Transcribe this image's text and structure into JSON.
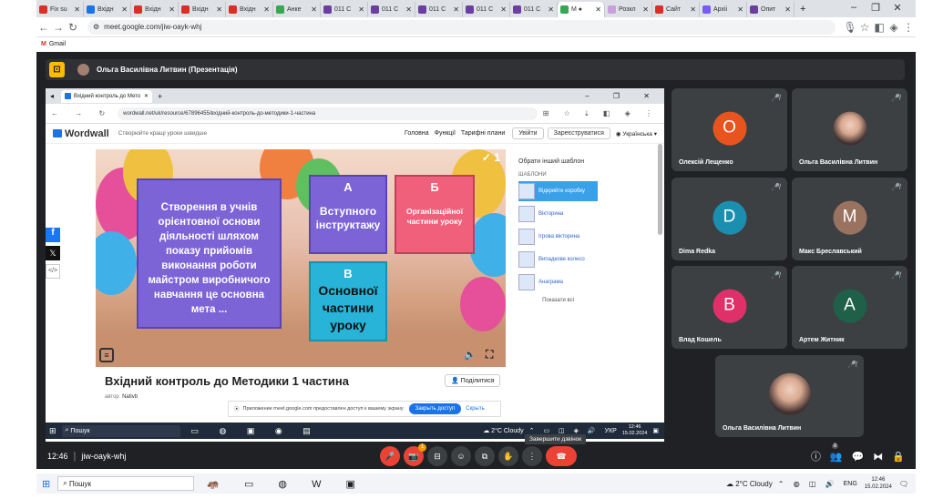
{
  "outer_tabs": [
    {
      "label": "Fix su",
      "color": "#d93025"
    },
    {
      "label": "Вхідн",
      "color": "#1a73e8"
    },
    {
      "label": "Вхідн",
      "color": "#d93025"
    },
    {
      "label": "Вхідн",
      "color": "#d93025"
    },
    {
      "label": "Вхідн",
      "color": "#d93025"
    },
    {
      "label": "Анке",
      "color": "#34a853"
    },
    {
      "label": "011 С",
      "color": "#6a3fa0"
    },
    {
      "label": "011 С",
      "color": "#6a3fa0"
    },
    {
      "label": "011 С",
      "color": "#6a3fa0"
    },
    {
      "label": "011 С",
      "color": "#6a3fa0"
    },
    {
      "label": "011 С",
      "color": "#6a3fa0"
    },
    {
      "label": "М ●",
      "color": "#34a853",
      "active": true
    },
    {
      "label": "Розкл",
      "color": "#c9a0dc"
    },
    {
      "label": "Сайт",
      "color": "#d93025"
    },
    {
      "label": "Архіі",
      "color": "#7a5af5"
    },
    {
      "label": "Опит",
      "color": "#6a3fa0"
    }
  ],
  "address": {
    "url": "meet.google.com/jiw-oayk-whj"
  },
  "bookmarks": {
    "gmail": "Gmail"
  },
  "meet_header": {
    "title": "Ольга Василівна Литвин (Презентація)"
  },
  "inner_browser": {
    "tab_label": "Вхідний контроль до Мето",
    "url": "wordwall.net/uk/resource/67896455/вхідний-контроль-до-методики-1-частина"
  },
  "wordwall": {
    "logo": "Wordwall",
    "tagline": "Створюйте кращі уроки швидше",
    "nav": [
      "Головна",
      "Функції",
      "Тарифні плани"
    ],
    "login": "Увійти",
    "register": "Зареєструватися",
    "language": "Українська",
    "question": "Створення в учнів орієнтовної основи діяльності шляхом показу прийомів виконання роботи майстром виробничого навчання це основна мета ...",
    "answers": [
      {
        "letter": "А",
        "text": "Вступного інструктажу",
        "color": "#7c63d6"
      },
      {
        "letter": "Б",
        "text": "Організаційної частини уроку",
        "color": "#f0607a"
      },
      {
        "letter": "В",
        "text": "Основної частини уроку",
        "color": "#28b4d8"
      }
    ],
    "check_count": "1",
    "side_title": "Обрати інший шаблон",
    "side_section": "ШАБЛОНИ",
    "templates": [
      "Відкрийте коробку",
      "Вікторина",
      "Ігрова вікторина",
      "Випадкове колесо",
      "Анаграма"
    ],
    "show_all": "Показати всі",
    "resource_title": "Вхідний контроль до Методики 1 частина",
    "author_label": "автор",
    "author": "Nativb",
    "share": "Поділитися",
    "banner_text": "Приложение meet.google.com предоставлен доступ к вашему экрану",
    "banner_stop": "Закрыть доступ",
    "banner_hide": "Скрыть"
  },
  "inner_taskbar": {
    "search": "Пошук",
    "weather": "2°C Cloudy",
    "lang": "УКР",
    "time": "12:46",
    "date": "15.02.2024"
  },
  "participants": [
    {
      "name": "Олексій Лещенко",
      "initial": "О",
      "color": "#e8541e",
      "photo": false
    },
    {
      "name": "Ольга Василівна Литвин",
      "initial": "",
      "color": "",
      "photo": true
    },
    {
      "name": "Dima Redka",
      "initial": "D",
      "color": "#1a8fb0",
      "photo": false
    },
    {
      "name": "Макс Бреславський",
      "initial": "M",
      "color": "#9a7360",
      "photo": false
    },
    {
      "name": "Влад Кошель",
      "initial": "B",
      "color": "#e0306a",
      "photo": false
    },
    {
      "name": "Артем Житник",
      "initial": "A",
      "color": "#1e6048",
      "photo": false
    },
    {
      "name": "Ольга Василівна Литвин",
      "initial": "",
      "color": "",
      "photo": true
    }
  ],
  "meetbar": {
    "time": "12:46",
    "code": "jiw-oayk-whj",
    "tooltip": "Завершити дзвінок",
    "people_count": "8",
    "chat_badge": "1"
  },
  "taskbar": {
    "search": "Пошук",
    "weather": "2°C Cloudy",
    "lang": "ENG",
    "time": "12:46",
    "date": "15.02.2024"
  }
}
